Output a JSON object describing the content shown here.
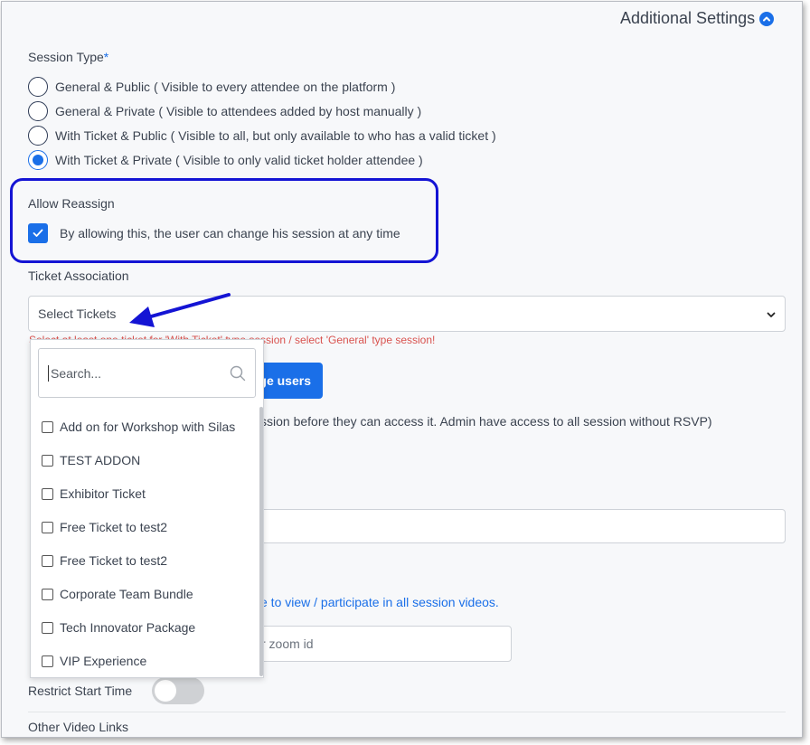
{
  "header": {
    "title": "Additional Settings",
    "icon": "chevron-up-circle-icon"
  },
  "session_type": {
    "label": "Session Type",
    "required_mark": "*",
    "options": [
      {
        "label": "General & Public ( Visible to every attendee on the platform )",
        "checked": false
      },
      {
        "label": "General & Private ( Visible to attendees added by host manually )",
        "checked": false
      },
      {
        "label": "With Ticket & Public ( Visible to all, but only available to who has a valid ticket )",
        "checked": false
      },
      {
        "label": "With Ticket & Private ( Visible to only valid ticket holder attendee )",
        "checked": true
      }
    ]
  },
  "allow_reassign": {
    "label": "Allow Reassign",
    "checkbox_label": "By allowing this, the user can change his session at any time",
    "checked": true
  },
  "ticket_association": {
    "label": "Ticket Association",
    "placeholder": "Select Tickets",
    "error": "Select at least one ticket for 'With Ticket' type session / select 'General' type session!",
    "dropdown": {
      "search_placeholder": "Search...",
      "options": [
        "Add on for Workshop with Silas",
        "TEST ADDON",
        "Exhibitor Ticket",
        "Free Ticket to test2",
        "Free Ticket to test2",
        "Corporate Team Bundle",
        "Tech Innovator Package",
        "VIP Experience"
      ]
    }
  },
  "manage_users_button": "ge users",
  "rsvp_help": "ssion before they can access it. Admin have access to all session without RSVP)",
  "video_link": "e to view / participate in all session videos.",
  "zoom_placeholder": "r zoom id",
  "restrict_start_time": {
    "label": "Restrict Start Time",
    "enabled": false
  },
  "other_video_links": {
    "label": "Other Video Links"
  },
  "colors": {
    "accent": "#1a6fe8",
    "annotation": "#1414d4",
    "error": "#d9534f"
  }
}
